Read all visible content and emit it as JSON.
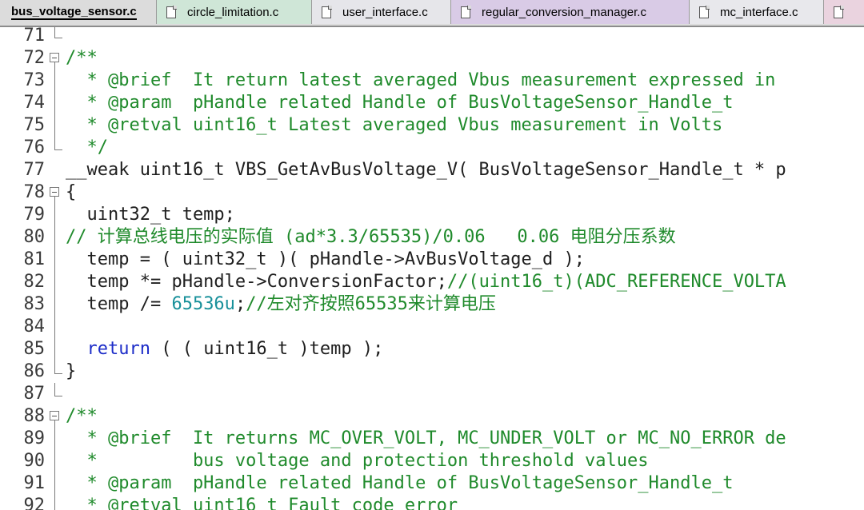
{
  "tabs": [
    {
      "label": "bus_voltage_sensor.c",
      "bg": "#dcdcdc",
      "width": 196,
      "active": true
    },
    {
      "label": "circle_limitation.c",
      "bg": "#cfe6d7",
      "width": 194
    },
    {
      "label": "user_interface.c",
      "bg": "#e6e6ea",
      "width": 174
    },
    {
      "label": "regular_conversion_manager.c",
      "bg": "#d9cbe6",
      "width": 298
    },
    {
      "label": "mc_interface.c",
      "bg": "#e8e8ec",
      "width": 168
    },
    {
      "label": "",
      "bg": "#ead3df",
      "width": 60
    }
  ],
  "lines": [
    {
      "num": "71",
      "fold": "end",
      "segs": [
        [
          "",
          ""
        ]
      ]
    },
    {
      "num": "72",
      "fold": "box",
      "segs": [
        [
          "/**",
          "cm"
        ]
      ]
    },
    {
      "num": "73",
      "fold": "bar",
      "segs": [
        [
          "  * @brief  It return latest averaged Vbus measurement expressed in",
          "cm"
        ]
      ]
    },
    {
      "num": "74",
      "fold": "bar",
      "segs": [
        [
          "  * @param  pHandle related Handle of BusVoltageSensor_Handle_t",
          "cm"
        ]
      ]
    },
    {
      "num": "75",
      "fold": "bar",
      "segs": [
        [
          "  * @retval uint16_t Latest averaged Vbus measurement in Volts",
          "cm"
        ]
      ]
    },
    {
      "num": "76",
      "fold": "end",
      "segs": [
        [
          "  */",
          "cm"
        ]
      ]
    },
    {
      "num": "77",
      "fold": "",
      "segs": [
        [
          "__weak uint16_t VBS_GetAvBusVoltage_V( BusVoltageSensor_Handle_t * p",
          ""
        ]
      ]
    },
    {
      "num": "78",
      "fold": "box",
      "segs": [
        [
          "{",
          ""
        ]
      ]
    },
    {
      "num": "79",
      "fold": "bar",
      "segs": [
        [
          "  uint32_t temp;",
          ""
        ]
      ]
    },
    {
      "num": "80",
      "fold": "bar",
      "segs": [
        [
          "// 计算总线电压的实际值 (ad*3.3/65535)/0.06   0.06 电阻分压系数",
          "cm"
        ]
      ]
    },
    {
      "num": "81",
      "fold": "bar",
      "segs": [
        [
          "  temp = ( uint32_t )( pHandle->AvBusVoltage_d );",
          ""
        ]
      ]
    },
    {
      "num": "82",
      "fold": "bar",
      "segs": [
        [
          "  temp *= pHandle->ConversionFactor;",
          ""
        ],
        [
          "//(uint16_t)(ADC_REFERENCE_VOLTA",
          "cm"
        ]
      ]
    },
    {
      "num": "83",
      "fold": "bar",
      "segs": [
        [
          "  temp /= ",
          ""
        ],
        [
          "65536u",
          "num"
        ],
        [
          ";",
          ""
        ],
        [
          "//左对齐按照65535来计算电压",
          "cm"
        ]
      ]
    },
    {
      "num": "84",
      "fold": "bar",
      "segs": [
        [
          "",
          ""
        ]
      ]
    },
    {
      "num": "85",
      "fold": "bar",
      "segs": [
        [
          "  ",
          ""
        ],
        [
          "return",
          "kw"
        ],
        [
          " ( ( uint16_t )temp );",
          ""
        ]
      ]
    },
    {
      "num": "86",
      "fold": "end",
      "segs": [
        [
          "}",
          ""
        ]
      ]
    },
    {
      "num": "87",
      "fold": "end",
      "segs": [
        [
          "",
          ""
        ]
      ]
    },
    {
      "num": "88",
      "fold": "box",
      "segs": [
        [
          "/**",
          "cm"
        ]
      ]
    },
    {
      "num": "89",
      "fold": "bar",
      "segs": [
        [
          "  * @brief  It returns MC_OVER_VOLT, MC_UNDER_VOLT or MC_NO_ERROR de",
          "cm"
        ]
      ]
    },
    {
      "num": "90",
      "fold": "bar",
      "segs": [
        [
          "  *         bus voltage and protection threshold values",
          "cm"
        ]
      ]
    },
    {
      "num": "91",
      "fold": "bar",
      "segs": [
        [
          "  * @param  pHandle related Handle of BusVoltageSensor_Handle_t",
          "cm"
        ]
      ]
    },
    {
      "num": "92",
      "fold": "bar",
      "segs": [
        [
          "  * @retval uint16_t Fault code error",
          "cm"
        ]
      ]
    }
  ]
}
